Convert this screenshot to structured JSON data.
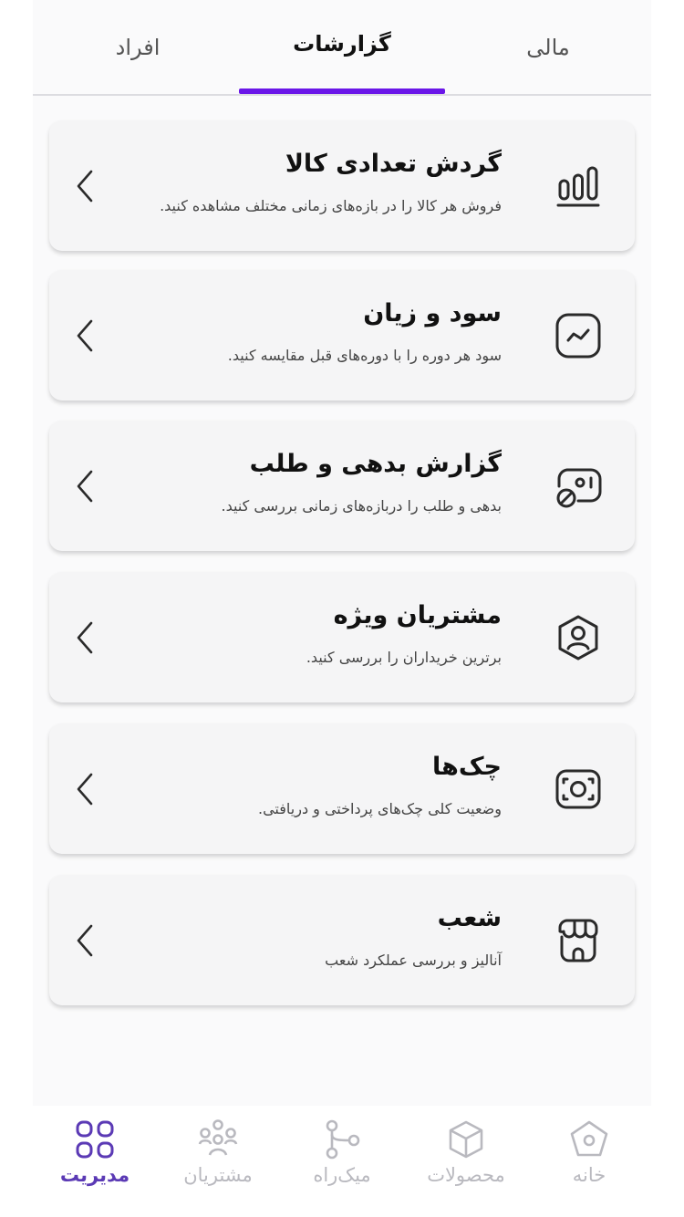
{
  "tabs": {
    "financial": "مالی",
    "reports": "گزارشات",
    "people": "افراد",
    "active": "reports",
    "accent_color": "#6a16e8"
  },
  "cards": [
    {
      "icon": "bar-chart-icon",
      "title": "گردش تعدادی کالا",
      "description": "فروش هر کالا را در بازه‌های زمانی مختلف مشاهده کنید."
    },
    {
      "icon": "trend-chart-icon",
      "title": "سود و زیان",
      "description": "سود هر دوره را با دوره‌های قبل مقایسه کنید."
    },
    {
      "icon": "receipt-coin-icon",
      "title": "گزارش بدهی و طلب",
      "description": "بدهی و طلب را دربازه‌های زمانی بررسی کنید."
    },
    {
      "icon": "user-badge-icon",
      "title": "مشتریان ویژه",
      "description": "برترین خریداران را بررسی کنید."
    },
    {
      "icon": "cheque-scan-icon",
      "title": "چک‌ها",
      "description": "وضعیت کلی چک‌های پرداختی و دریافتی."
    },
    {
      "icon": "shop-icon",
      "title": "شعب",
      "description": "آنالیز و بررسی عملکرد شعب"
    }
  ],
  "bottom_nav": {
    "items": [
      {
        "icon": "home-icon",
        "label": "خانه"
      },
      {
        "icon": "box-icon",
        "label": "محصولات"
      },
      {
        "icon": "route-icon",
        "label": "میک‌راه"
      },
      {
        "icon": "users-icon",
        "label": "مشتریان"
      },
      {
        "icon": "grid-icon",
        "label": "مدیریت"
      }
    ],
    "active": "مدیریت",
    "active_color": "#5b3ab5",
    "inactive_color": "#b9b9bf"
  }
}
